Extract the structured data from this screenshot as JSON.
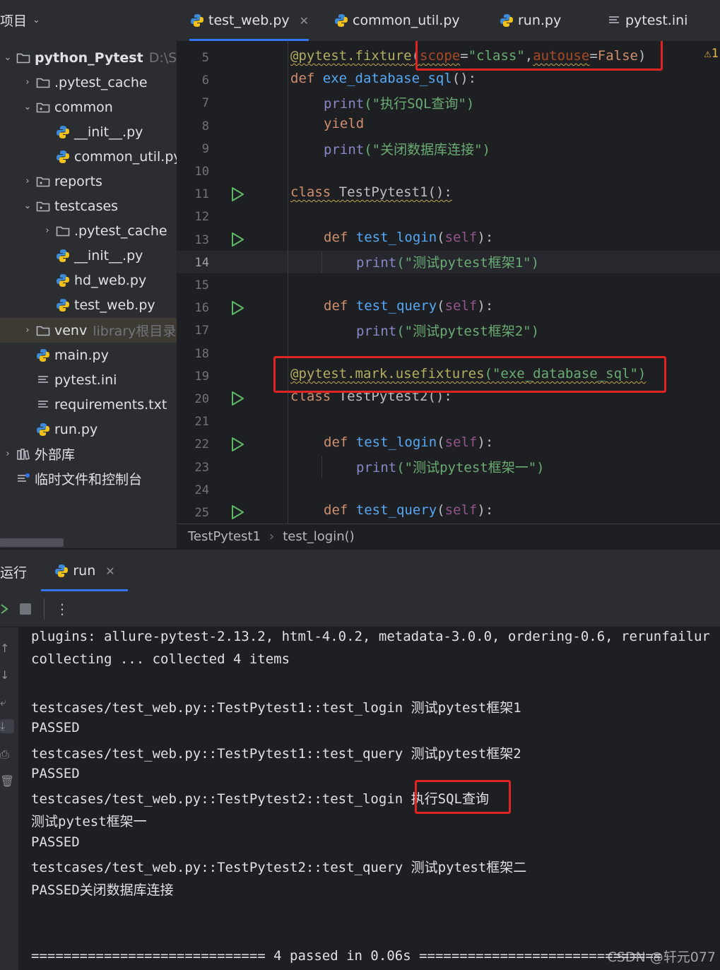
{
  "sidebar": {
    "title": "项目",
    "items": [
      {
        "label": "python_Pytest",
        "hint": "D:\\Sof",
        "type": "folder",
        "expanded": true,
        "bold": true
      },
      {
        "label": ".pytest_cache",
        "type": "folder"
      },
      {
        "label": "common",
        "type": "package",
        "expanded": true
      },
      {
        "label": "__init__.py",
        "type": "python"
      },
      {
        "label": "common_util.py",
        "type": "python"
      },
      {
        "label": "reports",
        "type": "package"
      },
      {
        "label": "testcases",
        "type": "package",
        "expanded": true
      },
      {
        "label": ".pytest_cache",
        "type": "folder"
      },
      {
        "label": "__init__.py",
        "type": "python"
      },
      {
        "label": "hd_web.py",
        "type": "python"
      },
      {
        "label": "test_web.py",
        "type": "python"
      },
      {
        "label": "venv",
        "hint": "library根目录",
        "type": "folder"
      },
      {
        "label": "main.py",
        "type": "python"
      },
      {
        "label": "pytest.ini",
        "type": "text"
      },
      {
        "label": "requirements.txt",
        "type": "text"
      },
      {
        "label": "run.py",
        "type": "python"
      },
      {
        "label": "外部库",
        "type": "library"
      },
      {
        "label": "临时文件和控制台",
        "type": "scratch"
      }
    ]
  },
  "tabs": [
    {
      "label": "test_web.py",
      "active": true,
      "icon": "python-icon"
    },
    {
      "label": "common_util.py",
      "icon": "python-icon"
    },
    {
      "label": "run.py",
      "icon": "python-icon"
    },
    {
      "label": "pytest.ini",
      "icon": "ini-file-icon"
    }
  ],
  "editor": {
    "warning_count": "1",
    "current_line": 14,
    "line_numbers": [
      "5",
      "6",
      "7",
      "8",
      "9",
      "10",
      "11",
      "12",
      "13",
      "14",
      "15",
      "16",
      "17",
      "18",
      "19",
      "20",
      "21",
      "22",
      "23",
      "24",
      "25"
    ],
    "code": {
      "l5_decorator": "@pytest.fixture",
      "l5_open": "(",
      "l5_scope_key": "scope",
      "l5_eq1": "=",
      "l5_scope_val": "\"class\"",
      "l5_comma": ",",
      "l5_autouse_key": "autouse",
      "l5_eq2": "=",
      "l5_autouse_val": "False",
      "l5_close": ")",
      "l6_def": "def ",
      "l6_name": "exe_database_sql",
      "l6_rest": "():",
      "l7_print": "print",
      "l7_arg": "(\"执行SQL查询\")",
      "l8_yield": "yield",
      "l9_print": "print",
      "l9_arg": "(\"关闭数据库连接\")",
      "l11_class": "class ",
      "l11_name": "TestPytest1():",
      "l13_def": "def ",
      "l13_name": "test_login",
      "l13_open": "(",
      "l13_self": "self",
      "l13_close": "):",
      "l14_print": "print",
      "l14_arg": "(\"测试pytest框架1\")",
      "l16_def": "def ",
      "l16_name": "test_query",
      "l16_open": "(",
      "l16_self": "self",
      "l16_close": "):",
      "l17_print": "print",
      "l17_arg": "(\"测试pytest框架2\")",
      "l19_decorator": "@pytest.mark.usefixtures",
      "l19_arg": "(\"exe_database_sql\")",
      "l20_class": "class ",
      "l20_name": "TestPytest2():",
      "l22_def": "def ",
      "l22_name": "test_login",
      "l22_open": "(",
      "l22_self": "self",
      "l22_close": "):",
      "l23_print": "print",
      "l23_arg": "(\"测试pytest框架一\")",
      "l25_def": "def ",
      "l25_name": "test_query",
      "l25_open": "(",
      "l25_self": "self",
      "l25_close": "):"
    }
  },
  "breadcrumb": [
    "TestPytest1",
    "test_login()"
  ],
  "run_panel": {
    "title": "运行",
    "tab_label": "run",
    "console": [
      "plugins: allure-pytest-2.13.2, html-4.0.2, metadata-3.0.0, ordering-0.6, rerunfailur",
      "collecting ... collected 4 items",
      "",
      "testcases/test_web.py::TestPytest1::test_login 测试pytest框架1",
      "PASSED",
      "testcases/test_web.py::TestPytest1::test_query 测试pytest框架2",
      "PASSED",
      "testcases/test_web.py::TestPytest2::test_login 执行SQL查询",
      "测试pytest框架一",
      "PASSED",
      "testcases/test_web.py::TestPytest2::test_query 测试pytest框架二",
      "PASSED关闭数据库连接",
      "",
      "",
      "============================= 4 passed in 0.06s =============================="
    ]
  },
  "watermark": "CSDN @轩元077",
  "colors": {
    "highlight_box": "#e02323",
    "accent": "#3574f0"
  }
}
